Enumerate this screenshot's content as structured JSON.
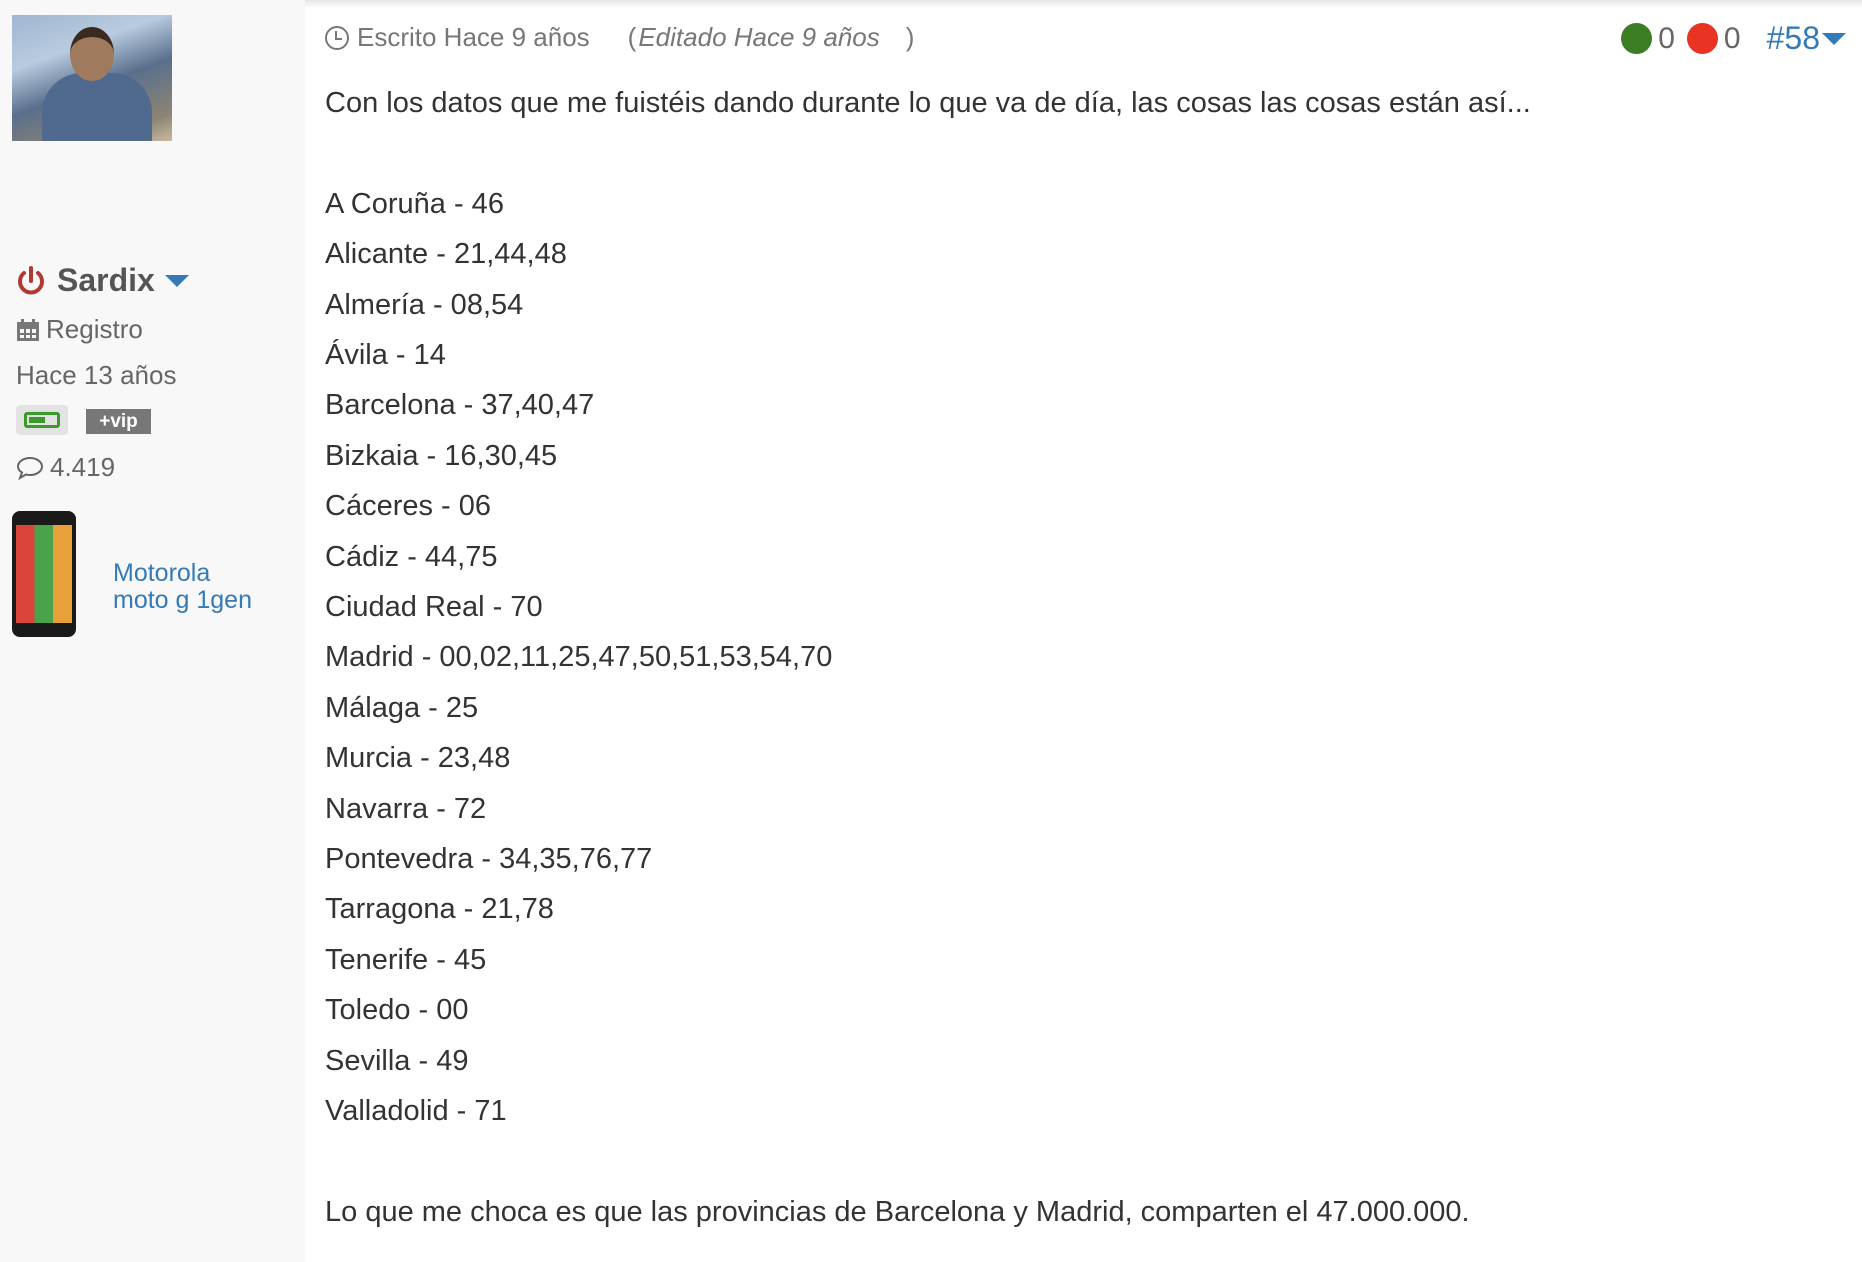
{
  "user": {
    "name": "Sardix",
    "registro_label": "Registro",
    "registro_value": "Hace 13 años",
    "badge_vip": "+vip",
    "comments": "4.419",
    "device": [
      "Motorola",
      "moto g 1gen"
    ]
  },
  "post": {
    "written": "Escrito Hace 9 años",
    "edited_open": "(",
    "edited": "Editado Hace 9 años",
    "edited_close": ")",
    "likes": "0",
    "dislikes": "0",
    "number": "#58",
    "colors": {
      "like": "#3a7d22",
      "dislike": "#e93323",
      "link": "#337ab7"
    },
    "intro": "Con los datos que me fuistéis dando durante lo que va de día, las cosas las cosas están así...",
    "lines": [
      "A Coruña - 46",
      "Alicante - 21,44,48",
      "Almería - 08,54",
      "Ávila - 14",
      "Barcelona - 37,40,47",
      "Bizkaia - 16,30,45",
      "Cáceres - 06",
      "Cádiz - 44,75",
      "Ciudad Real - 70",
      "Madrid - 00,02,11,25,47,50,51,53,54,70",
      "Málaga - 25",
      "Murcia - 23,48",
      "Navarra - 72",
      "Pontevedra - 34,35,76,77",
      "Tarragona - 21,78",
      "Tenerife - 45",
      "Toledo - 00",
      "Sevilla - 49",
      "Valladolid - 71"
    ],
    "outro": "Lo que me choca es que las provincias de Barcelona y Madrid, comparten el 47.000.000."
  }
}
